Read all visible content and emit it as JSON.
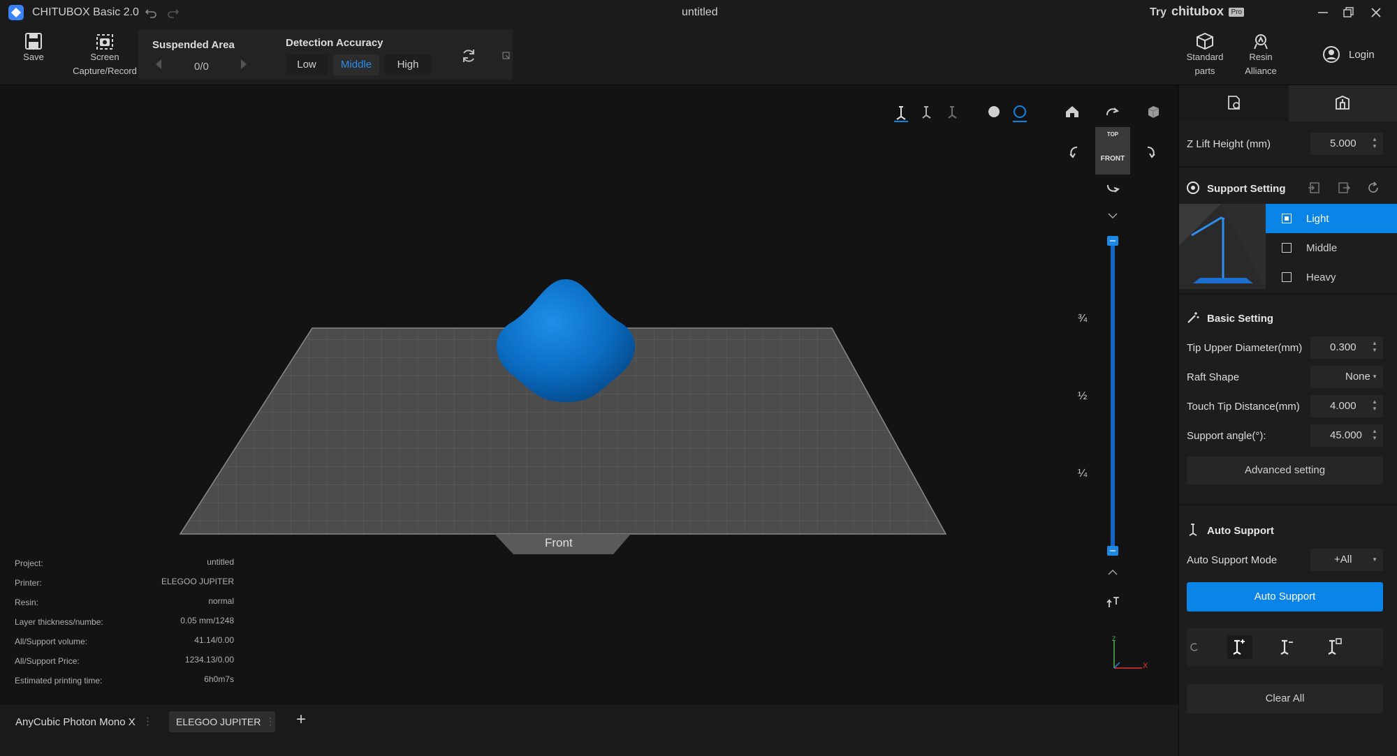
{
  "app": {
    "title": "CHITUBOX Basic 2.0",
    "document": "untitled",
    "try_prefix": "Try",
    "brand": "chitubox",
    "brand_badge": "Pro",
    "accent": "#0a84e6"
  },
  "toolbar": {
    "save": "Save",
    "screen_capture_1": "Screen",
    "screen_capture_2": "Capture/Record",
    "suspended_area": {
      "title": "Suspended Area",
      "counter": "0/0"
    },
    "detection_accuracy": {
      "title": "Detection Accuracy",
      "options": [
        "Low",
        "Middle",
        "High"
      ],
      "selected": "Middle"
    },
    "standard_parts_1": "Standard",
    "standard_parts_2": "parts",
    "resin_alliance_1": "Resin",
    "resin_alliance_2": "Alliance",
    "login": "Login"
  },
  "viewport": {
    "view_cube_top": "TOP",
    "view_cube_front": "FRONT",
    "plate_label": "Front",
    "slider_marks": [
      "¾",
      "½",
      "¼"
    ],
    "axis_x": "X",
    "axis_z": "Z"
  },
  "info": {
    "rows": [
      {
        "k": "Project:",
        "v": "untitled"
      },
      {
        "k": "Printer:",
        "v": "ELEGOO JUPITER"
      },
      {
        "k": "Resin:",
        "v": "normal"
      },
      {
        "k": "Layer thickness/numbe:",
        "v": "0.05 mm/1248"
      },
      {
        "k": "All/Support volume:",
        "v": "41.14/0.00"
      },
      {
        "k": "All/Support Price:",
        "v": "1234.13/0.00"
      },
      {
        "k": "Estimated printing time:",
        "v": "6h0m7s"
      }
    ]
  },
  "printers": {
    "tabs": [
      "AnyCubic Photon Mono X",
      "ELEGOO JUPITER"
    ],
    "active": "ELEGOO JUPITER",
    "add": "+"
  },
  "panel": {
    "z_lift_label": "Z Lift Height (mm)",
    "z_lift_value": "5.000",
    "support_setting": "Support Setting",
    "presets": [
      "Light",
      "Middle",
      "Heavy"
    ],
    "preset_selected": "Light",
    "basic_setting": "Basic Setting",
    "tip_upper_label": "Tip Upper Diameter(mm)",
    "tip_upper_value": "0.300",
    "raft_shape_label": "Raft Shape",
    "raft_shape_value": "None",
    "touch_tip_label": "Touch Tip Distance(mm)",
    "touch_tip_value": "4.000",
    "support_angle_label": "Support angle(°):",
    "support_angle_value": "45.000",
    "advanced": "Advanced setting",
    "auto_support_head": "Auto Support",
    "auto_mode_label": "Auto Support Mode",
    "auto_mode_value": "+All",
    "auto_support_button": "Auto Support",
    "clear_all": "Clear All"
  }
}
